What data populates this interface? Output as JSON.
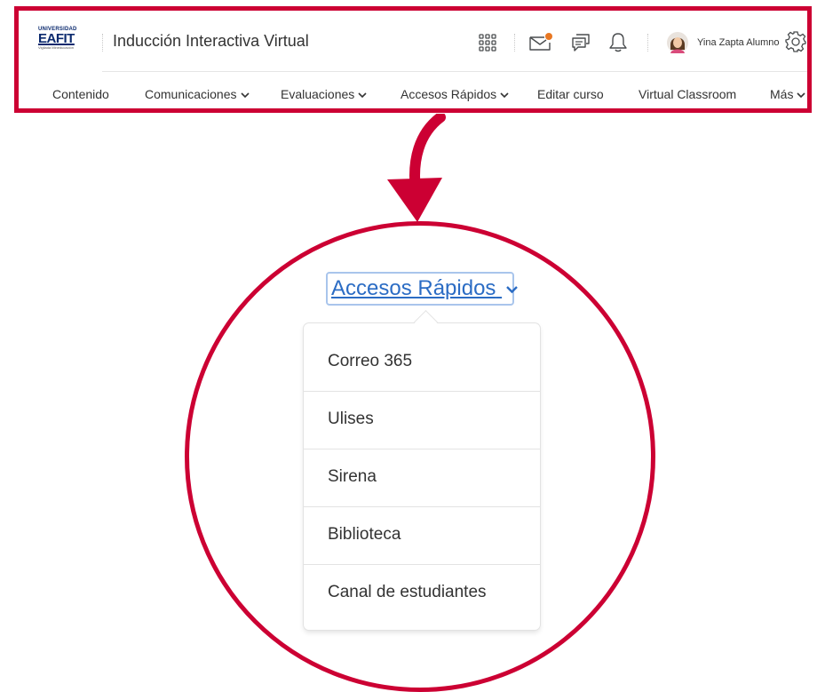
{
  "header": {
    "logo": {
      "line1": "UNIVERSIDAD",
      "line2": "EAFIT",
      "line3": "Vigilada Mineducación"
    },
    "course_title": "Inducción Interactiva Virtual",
    "icons": [
      "apps-grid-icon",
      "mail-icon",
      "chat-icon",
      "bell-icon",
      "avatar",
      "gear-icon"
    ],
    "user_name": "Yina Zapta Alumno",
    "accent_color": "#cc0033",
    "notification_dot_color": "#e87722"
  },
  "nav": {
    "items": [
      {
        "label": "Contenido",
        "has_dropdown": false
      },
      {
        "label": "Comunicaciones",
        "has_dropdown": true
      },
      {
        "label": "Evaluaciones",
        "has_dropdown": true
      },
      {
        "label": "Accesos Rápidos",
        "has_dropdown": true
      },
      {
        "label": "Editar curso",
        "has_dropdown": false
      },
      {
        "label": "Virtual Classroom",
        "has_dropdown": false
      },
      {
        "label": "Más",
        "has_dropdown": true
      }
    ]
  },
  "callout": {
    "trigger_label": "Accesos Rápidos",
    "link_color": "#2b6cc4",
    "menu_items": [
      "Correo 365",
      "Ulises",
      "Sirena",
      "Biblioteca",
      "Canal de estudiantes"
    ]
  }
}
